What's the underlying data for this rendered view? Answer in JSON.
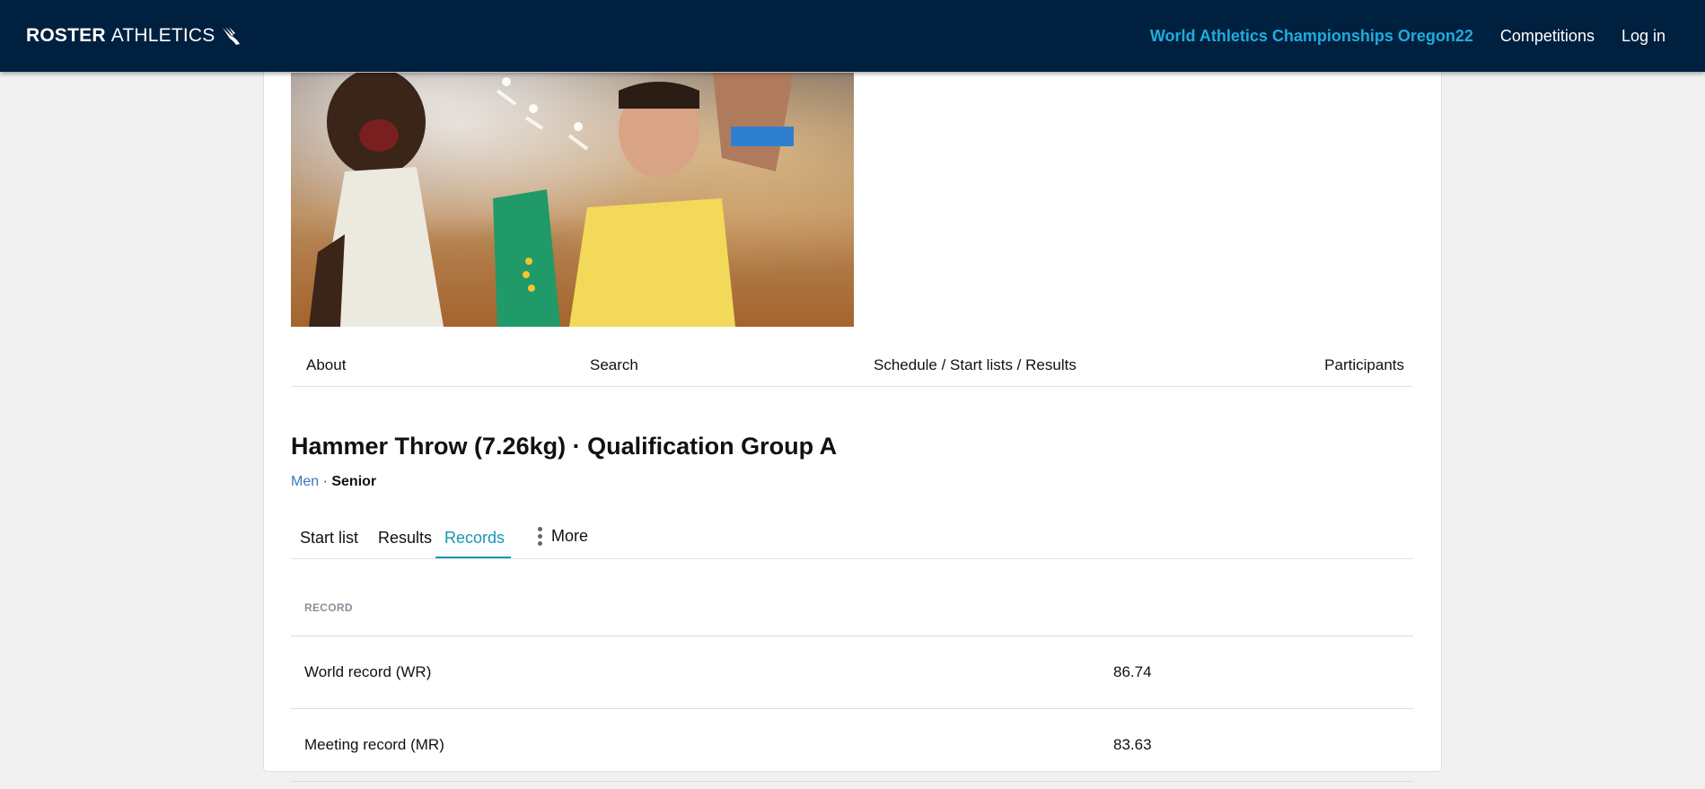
{
  "header": {
    "brand_bold": "ROSTER",
    "brand_light": "ATHLETICS",
    "links": [
      {
        "label": "World Athletics Championships Oregon22",
        "active": true
      },
      {
        "label": "Competitions",
        "active": false
      },
      {
        "label": "Log in",
        "active": false
      }
    ]
  },
  "section_tabs": [
    "About",
    "Search",
    "Schedule / Start lists / Results",
    "Participants"
  ],
  "event": {
    "title": "Hammer Throw (7.26kg) · Qualification Group A",
    "gender": "Men",
    "separator": "·",
    "category": "Senior"
  },
  "sub_tabs": {
    "items": [
      "Start list",
      "Results",
      "Records"
    ],
    "active": "Records",
    "more_label": "More"
  },
  "records": {
    "header": "RECORD",
    "rows": [
      {
        "name": "World record (WR)",
        "value": "86.74"
      },
      {
        "name": "Meeting record (MR)",
        "value": "83.63"
      }
    ]
  },
  "colors": {
    "navbar": "#00203f",
    "accent": "#1eaddc",
    "active_tab": "#1896b6",
    "link_blue": "#3a78b8"
  }
}
